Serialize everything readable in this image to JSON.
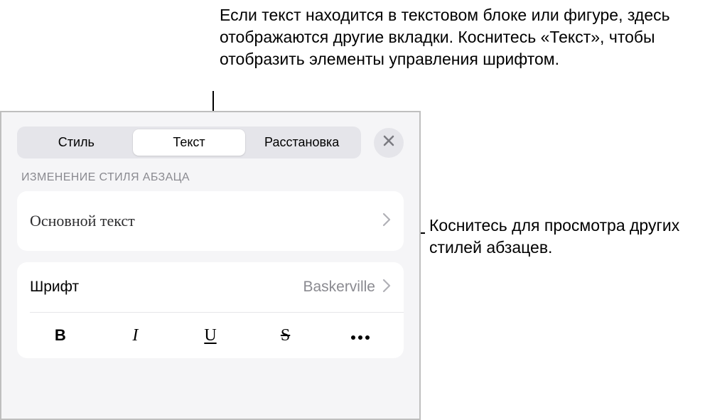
{
  "callout_top": "Если текст находится в текстовом блоке или фигуре, здесь отображаются другие вкладки. Коснитесь «Текст», чтобы отобразить элементы управления шрифтом.",
  "callout_right": "Коснитесь для просмотра других стилей абзацев.",
  "tabs": {
    "style": "Стиль",
    "text": "Текст",
    "arrange": "Расстановка"
  },
  "section_label": "ИЗМЕНЕНИЕ СТИЛЯ АБЗАЦА",
  "paragraph_style": {
    "value": "Основной текст"
  },
  "font": {
    "label": "Шрифт",
    "value": "Baskerville"
  },
  "format": {
    "bold": "B",
    "italic": "I",
    "underline": "U",
    "strike": "S"
  }
}
